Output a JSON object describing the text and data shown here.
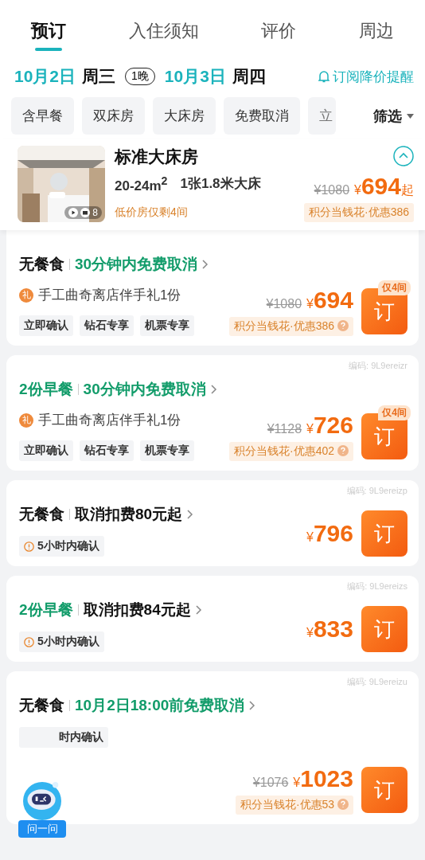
{
  "tabs": [
    {
      "label": "预订",
      "selected": true
    },
    {
      "label": "入住须知",
      "selected": false
    },
    {
      "label": "评价",
      "selected": false
    },
    {
      "label": "周边",
      "selected": false
    }
  ],
  "dates": {
    "checkin_date": "10月2日",
    "checkin_weekday": "周三",
    "nights": "1晚",
    "checkout_date": "10月3日",
    "checkout_weekday": "周四",
    "alert_link": "订阅降价提醒"
  },
  "filters": {
    "chips": [
      "含早餐",
      "双床房",
      "大床房",
      "免费取消",
      "立"
    ],
    "filter_button": "筛选"
  },
  "room": {
    "photo": {
      "kind": "picture",
      "media_count": "8"
    },
    "name": "标准大床房",
    "area": "20-24m$^{2}$",
    "bed": "1张1.8米大床",
    "stock_note": "低价房仅剩4间",
    "expanded": true,
    "original_price": "¥1080",
    "currency": "¥",
    "price": "694",
    "price_suffix": "起",
    "discount": "积分当钱花·优惠386"
  },
  "offers": [
    {
      "meal": "无餐食",
      "meal_included": false,
      "policy": "30分钟内免费取消",
      "free_cancel": true,
      "gift": "手工曲奇离店伴手礼1份",
      "gift_icon": "礼",
      "tags": [
        {
          "kind": "plain",
          "text": "立即确认"
        },
        {
          "kind": "plain",
          "text": "钻石专享"
        },
        {
          "kind": "plain",
          "text": "机票专享"
        }
      ],
      "original_price": "¥1080",
      "currency": "¥",
      "price": "694",
      "discount": "积分当钱花·优惠386",
      "book": "订",
      "stock_badge": "仅4间"
    },
    {
      "code": "编码: 9L9ereizr",
      "meal": "2份早餐",
      "meal_included": true,
      "policy": "30分钟内免费取消",
      "free_cancel": true,
      "gift": "手工曲奇离店伴手礼1份",
      "gift_icon": "礼",
      "tags": [
        {
          "kind": "plain",
          "text": "立即确认"
        },
        {
          "kind": "plain",
          "text": "钻石专享"
        },
        {
          "kind": "plain",
          "text": "机票专享"
        }
      ],
      "original_price": "¥1128",
      "currency": "¥",
      "price": "726",
      "discount": "积分当钱花·优惠402",
      "book": "订",
      "stock_badge": "仅4间"
    },
    {
      "code": "编码: 9L9ereizp",
      "meal": "无餐食",
      "meal_included": false,
      "policy": "取消扣费80元起",
      "free_cancel": false,
      "tags": [
        {
          "kind": "warning",
          "text": "5小时内确认"
        }
      ],
      "currency": "¥",
      "price": "796",
      "book": "订"
    },
    {
      "code": "编码: 9L9ereizs",
      "meal": "2份早餐",
      "meal_included": true,
      "policy": "取消扣费84元起",
      "free_cancel": false,
      "tags": [
        {
          "kind": "warning",
          "text": "5小时内确认"
        }
      ],
      "currency": "¥",
      "price": "833",
      "book": "订"
    },
    {
      "code": "编码: 9L9ereizu",
      "meal": "无餐食",
      "meal_included": false,
      "policy": "10月2日18:00前免费取消",
      "free_cancel": true,
      "tags": [
        {
          "kind": "covered",
          "text": "时内确认"
        }
      ],
      "original_price": "¥1076",
      "currency": "¥",
      "price": "1023",
      "discount": "积分当钱花·优惠53",
      "book": "订"
    }
  ],
  "assistant": {
    "label": "问一问"
  }
}
